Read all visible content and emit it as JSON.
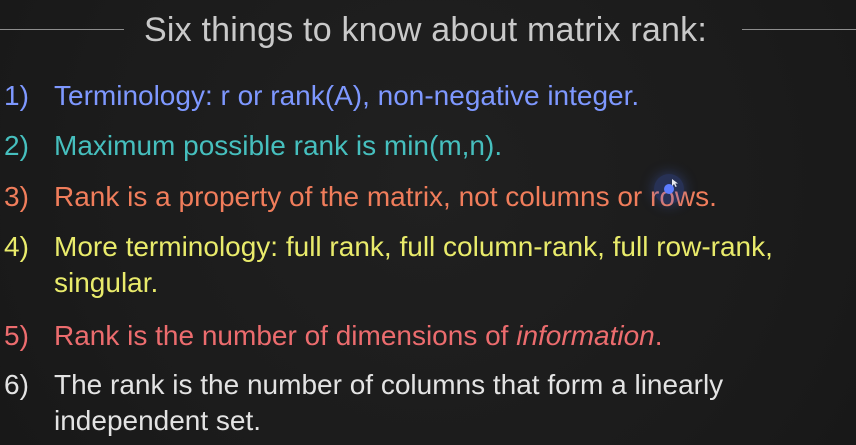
{
  "slide": {
    "title": "Six things to know about matrix rank:",
    "items": [
      {
        "number": "1)",
        "text": "Terminology: r or rank(A), non-negative integer."
      },
      {
        "number": "2)",
        "text": "Maximum possible rank is min(m,n)."
      },
      {
        "number": "3)",
        "text": "Rank is a property of the matrix, not columns or rows."
      },
      {
        "number": "4)",
        "line1": "More terminology: full rank, full column-rank, full row-rank,",
        "line2": "singular."
      },
      {
        "number": "5)",
        "text_before": "Rank is the number of dimensions of ",
        "text_emphasis": "information",
        "text_after": "."
      },
      {
        "number": "6)",
        "line1": "The rank is the number of columns that form a linearly",
        "line2": "independent set."
      }
    ]
  },
  "colors": {
    "background": "#1d1d1d",
    "title": "#c9c9c9",
    "item1": "#7e98ff",
    "item2": "#46bfbe",
    "item3": "#f07d5b",
    "item4": "#e9eb6b",
    "item5": "#ec6c6e",
    "item6": "#e3e3e3"
  }
}
